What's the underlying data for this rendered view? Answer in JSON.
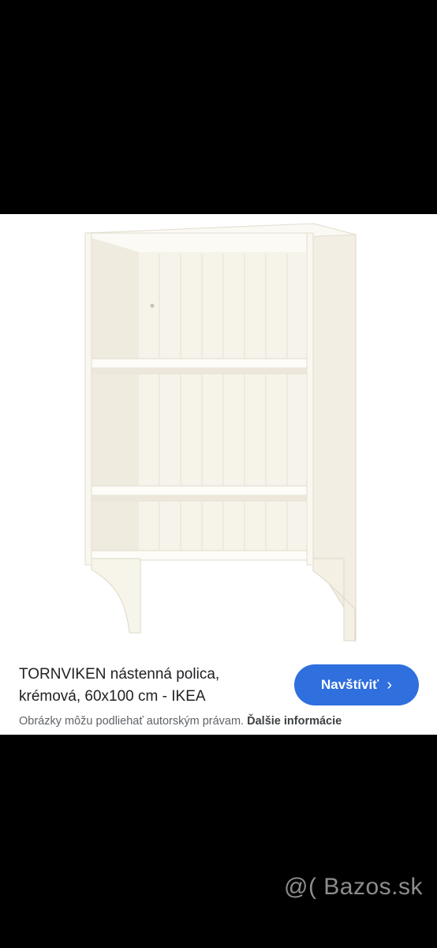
{
  "result": {
    "title": "TORNVIKEN nástenná polica, krémová, 60x100 cm - IKEA",
    "visit_label": "Navštíviť",
    "visit_icon": "chevron-right-icon",
    "copyright_notice": "Obrázky môžu podliehať autorským právam.",
    "more_info_link": "Ďalšie informácie",
    "image_subject": "shelf-unit-image"
  },
  "watermark": {
    "text": "@( Bazos.sk"
  },
  "colors": {
    "button_bg": "#2f6fde",
    "card_bg": "#ffffff",
    "backdrop": "#000000",
    "shelf_cream": "#f7f4ea"
  }
}
